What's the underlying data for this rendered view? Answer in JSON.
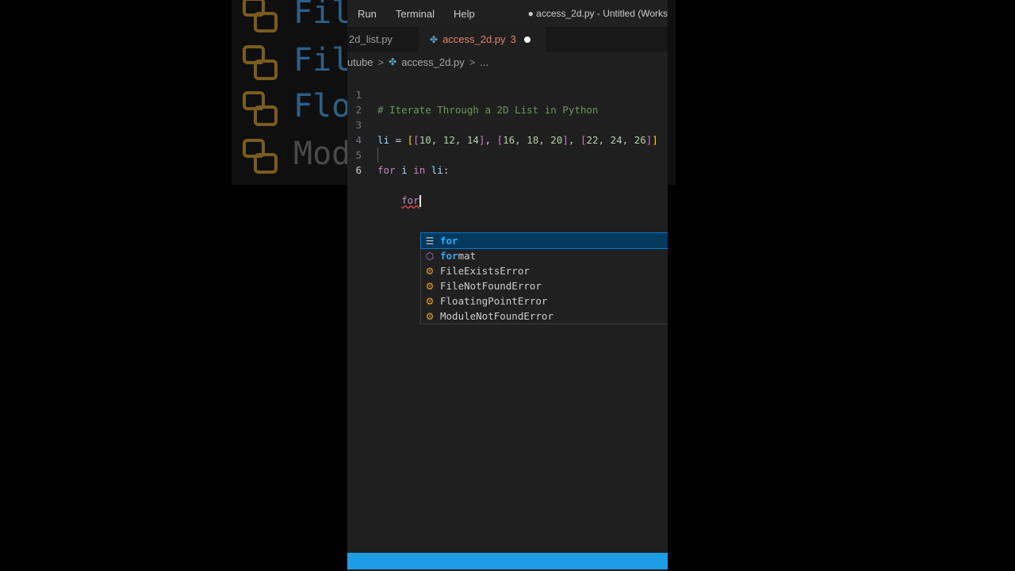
{
  "background": {
    "items": [
      {
        "hl": "Fil",
        "rest": ""
      },
      {
        "hl": "Fil",
        "rest": ""
      },
      {
        "hl": "Flo",
        "rest": ""
      },
      {
        "hl": "",
        "rest": "Mod"
      }
    ]
  },
  "menu": [
    "Run",
    "Terminal",
    "Help"
  ],
  "window_title": "● access_2d.py - Untitled (Works",
  "tabs": [
    {
      "label": "2d_list.py"
    },
    {
      "label": "access_2d.py",
      "problems": "3"
    }
  ],
  "breadcrumb": {
    "folder": "utube",
    "sep1": ">",
    "file": "access_2d.py",
    "sep2": ">",
    "more": "..."
  },
  "code": {
    "line_numbers": [
      "1",
      "2",
      "3",
      "4",
      "5",
      "6"
    ],
    "l1": "# Iterate Through a 2D List in Python",
    "l3": {
      "var": "li",
      "eq": " = ",
      "o1": "[",
      "o2": "[",
      "a": "10, 12, 14",
      "c2": "]",
      "comma1": ", ",
      "o3": "[",
      "b": "16, 18, 20",
      "c3": "]",
      "comma2": ", ",
      "o4": "[",
      "d": "22, 24, 26",
      "c4": "]",
      "c1": "]"
    },
    "l5": {
      "for": "for",
      "sp1": " ",
      "i": "i",
      "sp2": " ",
      "in": "in",
      "sp3": " ",
      "li": "li",
      "colon": ":"
    },
    "l6": {
      "indent": "    ",
      "typed": "for"
    }
  },
  "suggestions": [
    {
      "icon": "keyword-icon",
      "match": "for",
      "rest": ""
    },
    {
      "icon": "module-icon",
      "match": "for",
      "rest": "mat"
    },
    {
      "icon": "class-icon",
      "label": "FileExistsError"
    },
    {
      "icon": "class-icon",
      "label": "FileNotFoundError"
    },
    {
      "icon": "class-icon",
      "label": "FloatingPointError"
    },
    {
      "icon": "class-icon",
      "label": "ModuleNotFoundError"
    }
  ],
  "colors": {
    "statusbar": "#1e9ce6",
    "accent_tab": "#e2836b"
  }
}
